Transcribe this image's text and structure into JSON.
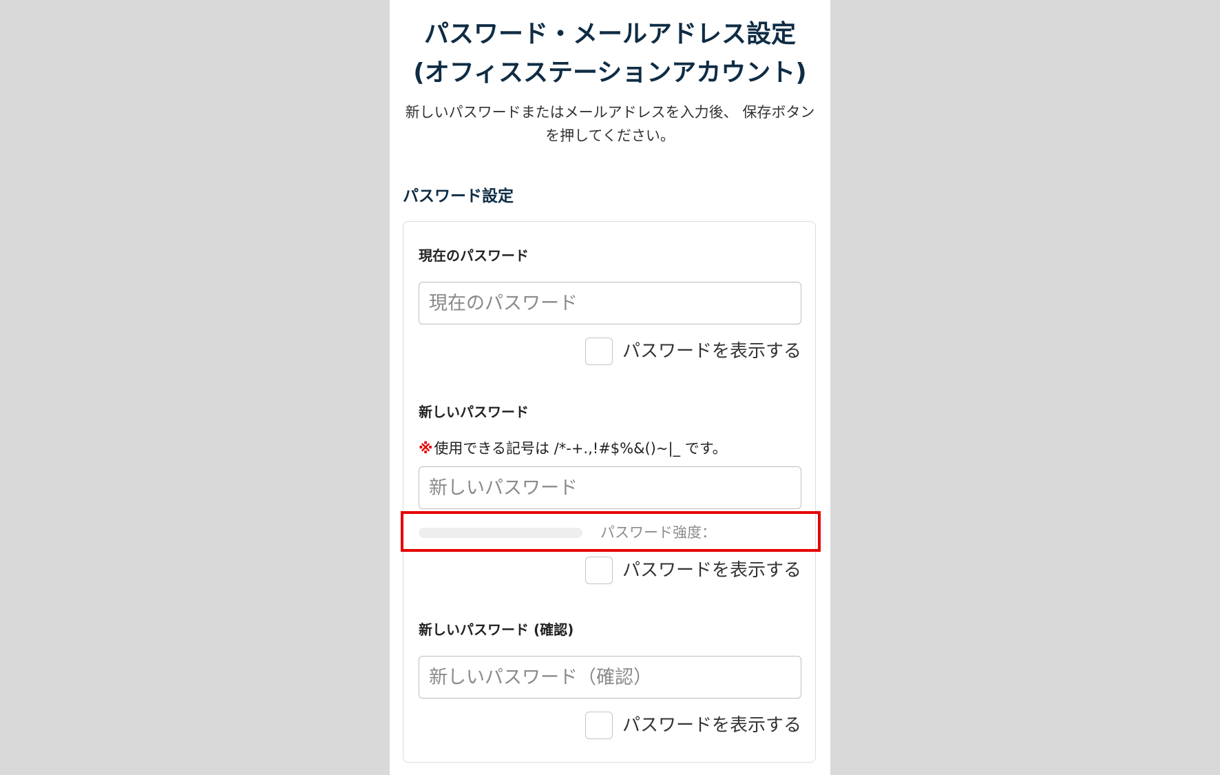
{
  "page": {
    "title_line1": "パスワード・メールアドレス設定",
    "title_line2": "(オフィスステーションアカウント)",
    "description": "新しいパスワードまたはメールアドレスを入力後、 保存ボタンを押してください。"
  },
  "password_section": {
    "heading": "パスワード設定",
    "current": {
      "label": "現在のパスワード",
      "placeholder": "現在のパスワード",
      "value": "",
      "show_label": "パスワードを表示する",
      "show_checked": false
    },
    "new": {
      "label": "新しいパスワード",
      "note_mark": "※",
      "note_text": "使用できる記号は /*-+.,!#$%&()~|_ です。",
      "placeholder": "新しいパスワード",
      "value": "",
      "strength_label": "パスワード強度：",
      "strength_value": 0,
      "show_label": "パスワードを表示する",
      "show_checked": false
    },
    "confirm": {
      "label": "新しいパスワード (確認)",
      "placeholder": "新しいパスワード（確認）",
      "value": "",
      "show_label": "パスワードを表示する",
      "show_checked": false
    }
  },
  "annotation": {
    "highlight_color": "#e60000"
  },
  "colors": {
    "heading": "#0f2c44",
    "note_mark": "#e60000",
    "background": "#d9d9d9",
    "panel": "#ffffff"
  }
}
